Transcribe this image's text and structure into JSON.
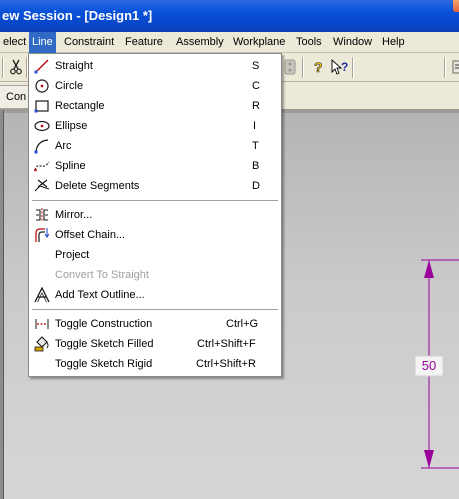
{
  "window": {
    "title": "ew Session - [Design1 *]"
  },
  "menubar": {
    "items": [
      "elect",
      "Line",
      "Constraint",
      "Feature",
      "Assembly",
      "Workplane",
      "Tools",
      "Window",
      "Help"
    ],
    "active": "Line"
  },
  "subbar": {
    "tab_label": "Con"
  },
  "line_menu": {
    "groups": [
      [
        {
          "label": "Straight",
          "shortcut": "S",
          "icon": "line-icon"
        },
        {
          "label": "Circle",
          "shortcut": "C",
          "icon": "circle-icon"
        },
        {
          "label": "Rectangle",
          "shortcut": "R",
          "icon": "rectangle-icon"
        },
        {
          "label": "Ellipse",
          "shortcut": "I",
          "icon": "ellipse-icon"
        },
        {
          "label": "Arc",
          "shortcut": "T",
          "icon": "arc-icon"
        },
        {
          "label": "Spline",
          "shortcut": "B",
          "icon": "spline-icon"
        },
        {
          "label": "Delete Segments",
          "shortcut": "D",
          "icon": "delete-segments-icon"
        }
      ],
      [
        {
          "label": "Mirror...",
          "shortcut": "",
          "icon": "mirror-icon"
        },
        {
          "label": "Offset Chain...",
          "shortcut": "",
          "icon": "offset-chain-icon"
        },
        {
          "label": "Project",
          "shortcut": "",
          "icon": ""
        },
        {
          "label": "Convert To Straight",
          "shortcut": "",
          "icon": "",
          "disabled": true
        },
        {
          "label": "Add Text Outline...",
          "shortcut": "",
          "icon": "text-outline-icon"
        }
      ],
      [
        {
          "label": "Toggle Construction",
          "shortcut": "Ctrl+G",
          "icon": "construction-icon"
        },
        {
          "label": "Toggle Sketch Filled",
          "shortcut": "Ctrl+Shift+F",
          "icon": "fill-icon"
        },
        {
          "label": "Toggle Sketch Rigid",
          "shortcut": "Ctrl+Shift+R",
          "icon": ""
        }
      ]
    ]
  },
  "dimension": {
    "value": "50",
    "color": "#9b009b"
  },
  "colors": {
    "menu_highlight": "#316ac5",
    "title_blue": "#0a52da"
  }
}
